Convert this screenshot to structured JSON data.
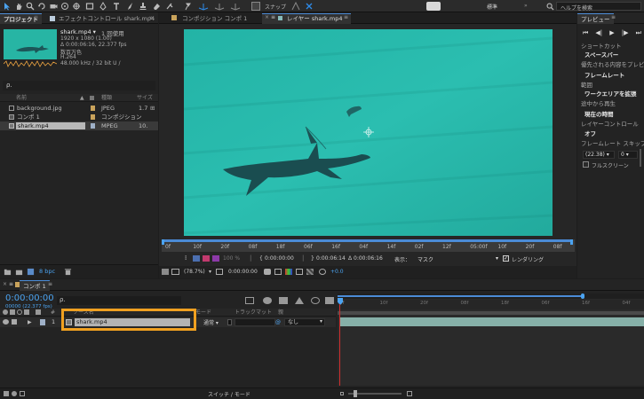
{
  "toolbar": {
    "snap_label": "スナップ",
    "workspace_label": "標準",
    "help_search_label": "ヘルプを検索"
  },
  "project_panel": {
    "tab_label": "プロジェクト",
    "effects_tab_label": "エフェクトコントロール shark.mp4",
    "selected_name": "shark.mp4 ▾",
    "usage": "1 回使用",
    "resolution": "1920 x 1080 (1.00)",
    "duration": "Δ 0:00:06:16, 22.377 fps",
    "color_label": "数百万色",
    "codec": "H.264",
    "audio_info": "48.000 kHz / 32 bit U /",
    "search_placeholder": "ρ.",
    "columns": {
      "name": "名前",
      "type": "種類",
      "size": "サイズ"
    },
    "items": [
      {
        "name": "background.jpg",
        "type": "JPEG",
        "size": "1.7",
        "color": "#c9a35b",
        "selected": false
      },
      {
        "name": "コンポ 1",
        "type": "コンポジション",
        "size": "",
        "color": "#c9a35b",
        "selected": false
      },
      {
        "name": "shark.mp4",
        "type": "MPEG",
        "size": "10.",
        "color": "#9fb1c8",
        "selected": true
      }
    ],
    "bpc_label": "8 bpc"
  },
  "viewer": {
    "comp_tab_label": "コンポジション コンポ 1",
    "layer_tab_label": "レイヤー shark.mp4",
    "ruler_ticks": [
      "0f",
      "10f",
      "20f",
      "08f",
      "18f",
      "06f",
      "16f",
      "04f",
      "14f",
      "02f",
      "12f",
      "05:00f",
      "10f",
      "20f",
      "08f"
    ],
    "transport": {
      "zoom": "100 %",
      "in_time": "0:00:00:00",
      "out_time": "0:00:06:14",
      "duration_time": "Δ 0:00:06:16",
      "view_label": "表示：",
      "view_value": "マスク",
      "render_label": "レンダリング"
    },
    "status": {
      "zoom": "(78.7%)",
      "time": "0:00:00:00",
      "exposure": "+0.0"
    }
  },
  "preview_panel": {
    "tab_label": "プレビュー",
    "shortcut_label": "ショートカット",
    "shortcut_value": "スペースバー",
    "priority_label": "優先される内容をプレビュー",
    "priority_value": "フレームレート",
    "range_label": "範囲",
    "range_value": "ワークエリアを拡張",
    "play_from_label": "途中から再生",
    "play_from_value": "現在の時間",
    "layer_control_label": "レイヤーコントロール",
    "layer_control_value": "オフ",
    "frame_rate_label": "フレームレート スキップ",
    "frame_rate_value": "(22.38) ▾",
    "skip_value": "0 ▾",
    "fullscreen_label": "フルスクリーン"
  },
  "timeline": {
    "tab_label": "コンポ 1",
    "timecode": "0:00:00:00",
    "timecode_sub": "00000 (22.377 fps)",
    "search_placeholder": "ρ.",
    "headers": {
      "source": "ソース名",
      "mode": "モード",
      "trackmatte": "トラックマット",
      "parent": "親"
    },
    "layer": {
      "index": "1",
      "name": "shark.mp4",
      "mode": "通常 ▾",
      "parent": "なし"
    },
    "ruler_ticks": [
      "0f",
      "10f",
      "20f",
      "08f",
      "18f",
      "06f",
      "16f",
      "04f"
    ],
    "footer_label": "スイッチ / モード"
  },
  "colors": {
    "accent": "#2d8ceb",
    "highlight_box": "#f0a020",
    "water": "#27b5a4",
    "playhead": "#d12f2f",
    "layer_bar": "#86b0a8"
  }
}
